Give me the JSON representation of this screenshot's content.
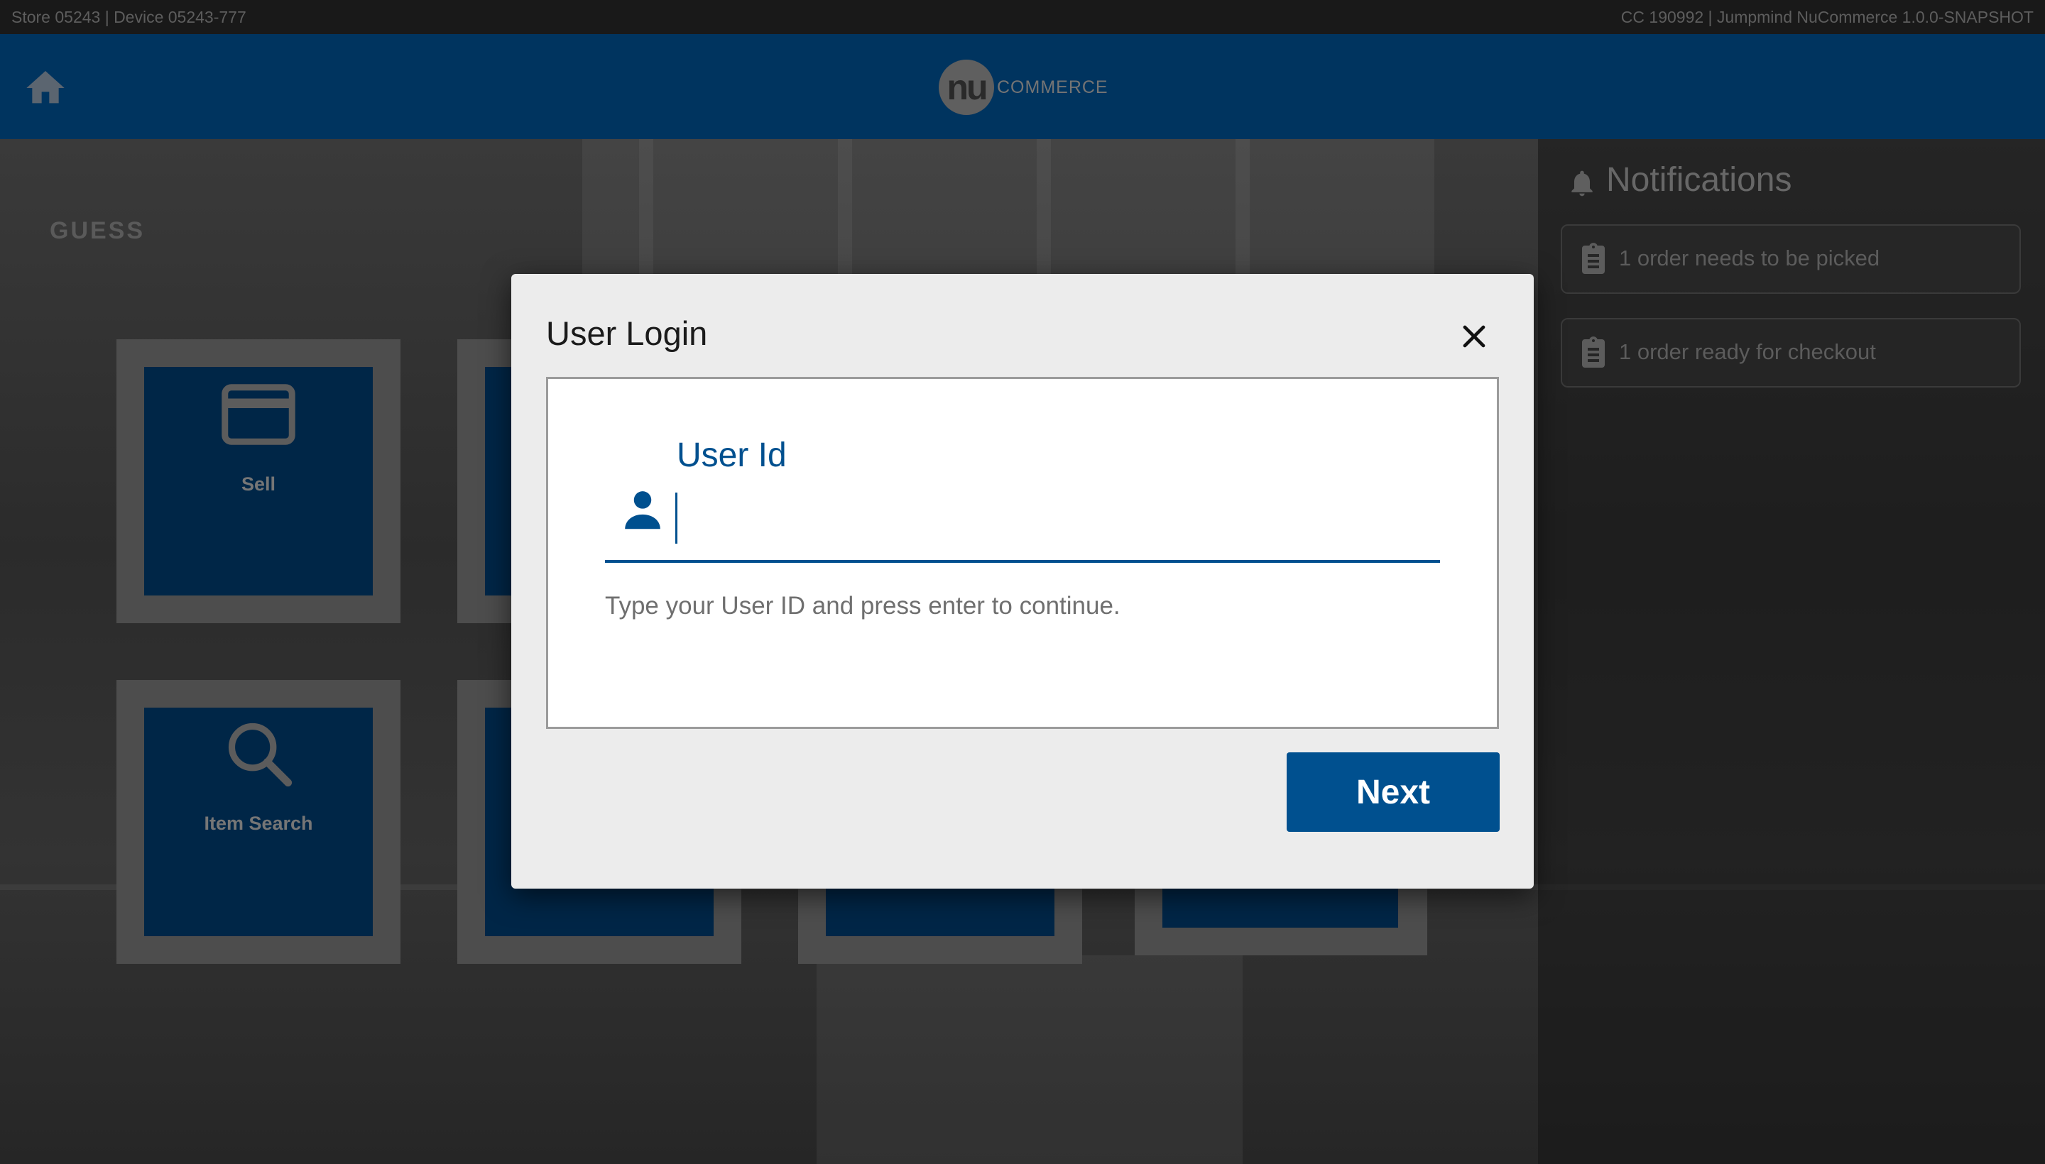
{
  "statusbar": {
    "left_text": "Store 05243 | Device 05243-777",
    "right_text": "CC 190992 | Jumpmind NuCommerce 1.0.0-SNAPSHOT"
  },
  "header": {
    "home_icon": "home-icon",
    "logo_mark": "nu",
    "logo_text": "COMMERCE"
  },
  "background": {
    "sign_text": "GUESS"
  },
  "tiles": [
    {
      "label": "Sell",
      "icon": "credit-card-icon"
    },
    {
      "label": "Item Search",
      "icon": "search-icon"
    }
  ],
  "notifications": {
    "title": "Notifications",
    "icon": "bell-icon",
    "items": [
      {
        "text": "1 order needs to be picked",
        "icon": "clipboard-icon"
      },
      {
        "text": "1 order ready for checkout",
        "icon": "clipboard-icon"
      }
    ]
  },
  "dialog": {
    "title": "User Login",
    "close_icon": "close-icon",
    "field_label": "User Id",
    "field_value": "",
    "field_icon": "person-icon",
    "hint": "Type your User ID and press enter to continue.",
    "next_label": "Next"
  },
  "colors": {
    "brand_blue": "#00508f",
    "header_blue": "#00345f",
    "dialog_bg": "#ececec"
  }
}
